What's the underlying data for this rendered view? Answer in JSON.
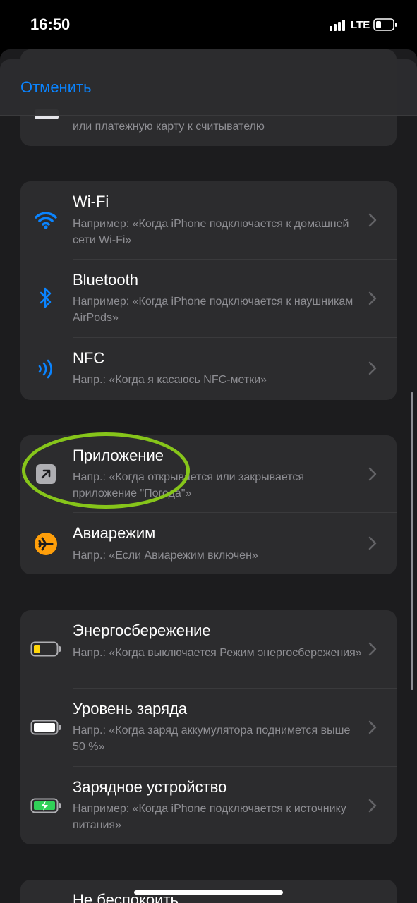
{
  "status_bar": {
    "time": "16:50",
    "network": "LTE"
  },
  "nav": {
    "cancel_label": "Отменить"
  },
  "top_card": {
    "subtitle_line2": "или платежную карту к считывателю"
  },
  "connectivity": [
    {
      "title": "Wi-Fi",
      "subtitle": "Например: «Когда iPhone подключается к домашней сети Wi-Fi»",
      "icon": "wifi-icon"
    },
    {
      "title": "Bluetooth",
      "subtitle": "Например: «Когда iPhone подключается к наушникам AirPods»",
      "icon": "bluetooth-icon"
    },
    {
      "title": "NFC",
      "subtitle": "Напр.: «Когда я касаюсь NFC-метки»",
      "icon": "nfc-icon"
    }
  ],
  "apps": [
    {
      "title": "Приложение",
      "subtitle": "Напр.: «Когда открывается или закрывается приложение \"Погода\"»",
      "icon": "app-arrow-icon"
    },
    {
      "title": "Авиарежим",
      "subtitle": "Напр.: «Если Авиарежим включен»",
      "icon": "airplane-icon"
    }
  ],
  "power": [
    {
      "title": "Энергосбережение",
      "subtitle": "Напр.: «Когда выключается Режим энергосбережения»",
      "icon": "low-power-battery-icon"
    },
    {
      "title": "Уровень заряда",
      "subtitle": "Напр.: «Когда заряд аккумулятора поднимется выше 50 %»",
      "icon": "battery-level-icon"
    },
    {
      "title": "Зарядное устройство",
      "subtitle": "Например: «Когда iPhone подключается к источнику питания»",
      "icon": "charging-battery-icon"
    }
  ],
  "bottom": {
    "title": "Не беспокоить"
  },
  "colors": {
    "accent": "#0a84ff",
    "airplane": "#ff9f0a",
    "low_power": "#ffd60a",
    "charging": "#30d158",
    "highlight": "#86c51a"
  }
}
